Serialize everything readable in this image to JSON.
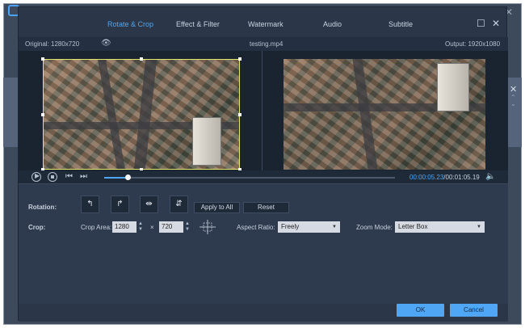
{
  "tabs": [
    {
      "label": "Rotate & Crop",
      "active": true
    },
    {
      "label": "Effect & Filter",
      "active": false
    },
    {
      "label": "Watermark",
      "active": false
    },
    {
      "label": "Audio",
      "active": false
    },
    {
      "label": "Subtitle",
      "active": false
    }
  ],
  "infobar": {
    "original": "Original: 1280x720",
    "filename": "testing.mp4",
    "output": "Output: 1920x1080"
  },
  "playback": {
    "current_time": "00:00:05.23",
    "duration": "/00:01:05.19",
    "progress": 0.08
  },
  "rotation": {
    "label": "Rotation:",
    "apply_label": "Apply to All",
    "reset_label": "Reset"
  },
  "crop": {
    "label": "Crop:",
    "area_label": "Crop Area:",
    "width": "1280",
    "times": "×",
    "height": "720",
    "aspect_label": "Aspect Ratio:",
    "aspect_value": "Freely",
    "zoom_label": "Zoom Mode:",
    "zoom_value": "Letter Box"
  },
  "footer": {
    "ok_label": "OK",
    "cancel_label": "Cancel"
  },
  "colors": {
    "accent": "#4ea6f5",
    "dialog_bg": "#2b3749",
    "crop_border": "#e6e66a"
  },
  "icons": [
    "play-icon",
    "stop-icon",
    "previous-frame-icon",
    "next-frame-icon",
    "volume-icon",
    "eye-icon",
    "minimize-icon",
    "close-icon"
  ]
}
